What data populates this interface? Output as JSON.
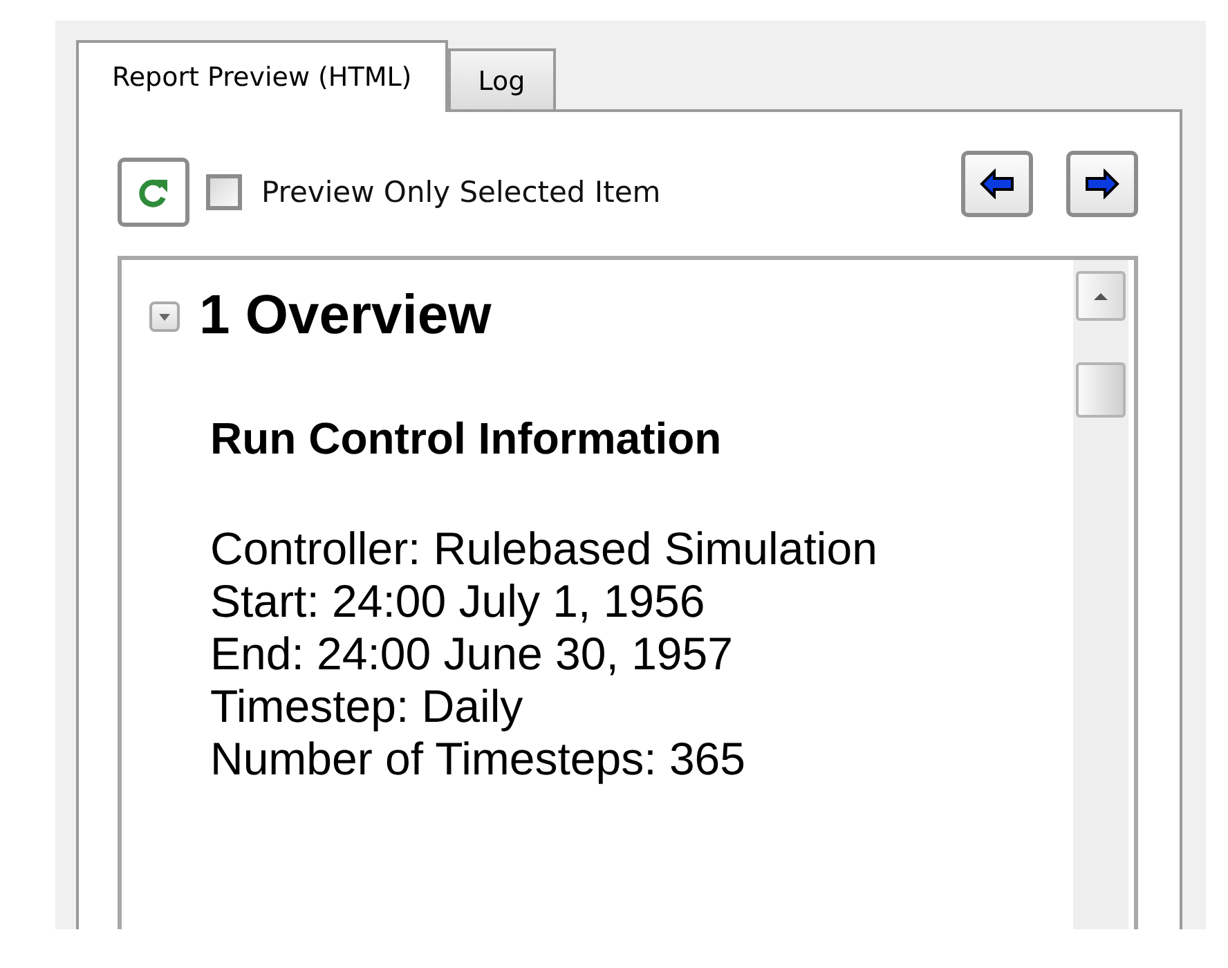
{
  "tabs": [
    {
      "label": "Report Preview (HTML)",
      "selected": true
    },
    {
      "label": "Log",
      "selected": false
    }
  ],
  "toolbar": {
    "preview_only_selected": {
      "label": "Preview Only Selected Item",
      "checked": false
    }
  },
  "report": {
    "section": {
      "title": "1 Overview",
      "expanded": true
    },
    "heading": "Run Control Information",
    "lines": [
      "Controller: Rulebased Simulation",
      "Start: 24:00 July 1, 1956",
      "End: 24:00 June 30, 1957",
      "Timestep: Daily",
      "Number of Timesteps: 365"
    ]
  }
}
